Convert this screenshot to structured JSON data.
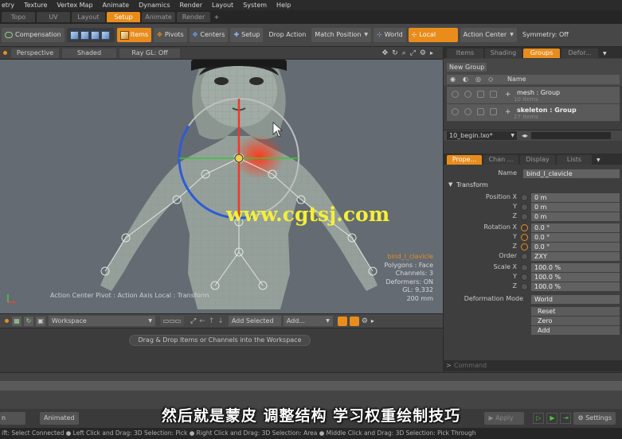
{
  "menu": [
    "etry",
    "Texture",
    "Vertex Map",
    "Animate",
    "Dynamics",
    "Render",
    "Layout",
    "System",
    "Help"
  ],
  "layout_tabs": [
    {
      "label": "Topo",
      "active": false
    },
    {
      "label": "UV",
      "active": false
    },
    {
      "label": "Layout",
      "active": false
    },
    {
      "label": "Setup",
      "active": true
    },
    {
      "label": "Animate",
      "active": false
    },
    {
      "label": "Render",
      "active": false
    }
  ],
  "layout_add": "+",
  "toolbar": {
    "compensation": "Compensation",
    "items": "Items",
    "pivots": "Pivots",
    "centers": "Centers",
    "setup": "Setup",
    "drop_action": "Drop Action",
    "match_position": "Match Position",
    "world": "World",
    "local": "Local",
    "action_center": "Action Center",
    "symmetry": "Symmetry: Off"
  },
  "viewport": {
    "view": "Perspective",
    "shading": "Shaded",
    "raygl": "Ray GL: Off",
    "watermark": "www.cgtsj.com",
    "info": {
      "selection": "bind_l_clavicle",
      "polygons": "Polygons : Face",
      "channels": "Channels: 3",
      "deformers": "Deformers: ON",
      "gl": "GL: 9,332",
      "distance": "200 mm"
    },
    "action_text": "Action Center Pivot : Action Axis Local : Transform"
  },
  "workspace": {
    "dropdown": "Workspace",
    "add_selected": "Add Selected",
    "add": "Add...",
    "drop_hint": "Drag & Drop Items or Channels into the Workspace"
  },
  "right_tabs": [
    "Items",
    "Shading",
    "Groups",
    "Defor..."
  ],
  "groups": {
    "new_group": "New Group",
    "name_col": "Name",
    "rows": [
      {
        "name": "mesh : Group",
        "count": "10 Items"
      },
      {
        "name": "skeleton : Group",
        "count": "27 Items"
      }
    ]
  },
  "scene_file": "10_begin.lxo*",
  "prop_tabs": [
    "Prope...",
    "Chan ...",
    "Display",
    "Lists"
  ],
  "properties": {
    "name_label": "Name",
    "name_value": "bind_l_clavicle",
    "transform": "Transform",
    "position_label": "Position X",
    "position": [
      "0 m",
      "0 m",
      "0 m"
    ],
    "rotation_label": "Rotation X",
    "rotation": [
      "0.0 °",
      "0.0 °",
      "0.0 °"
    ],
    "order_label": "Order",
    "order": "ZXY",
    "scale_label": "Scale X",
    "scale": [
      "100.0 %",
      "100.0 %",
      "100.0 %"
    ],
    "axis_y": "Y",
    "axis_z": "Z",
    "deformation_label": "Deformation Mode",
    "deformation": "World",
    "reset": "Reset",
    "zero": "Zero",
    "add": "Add"
  },
  "command": "Command",
  "bottom": {
    "editor": "n Editor",
    "animated": "Animated",
    "apply": "Apply",
    "settings": "Settings"
  },
  "subtitle": "然后就是蒙皮 调整结构 学习权重绘制技巧",
  "status": "ift: Select Connected  ●  Left Click and Drag: 3D Selection: Pick  ●  Right Click and Drag: 3D Selection: Area  ●  Middle Click and Drag: 3D Selection: Pick Through"
}
